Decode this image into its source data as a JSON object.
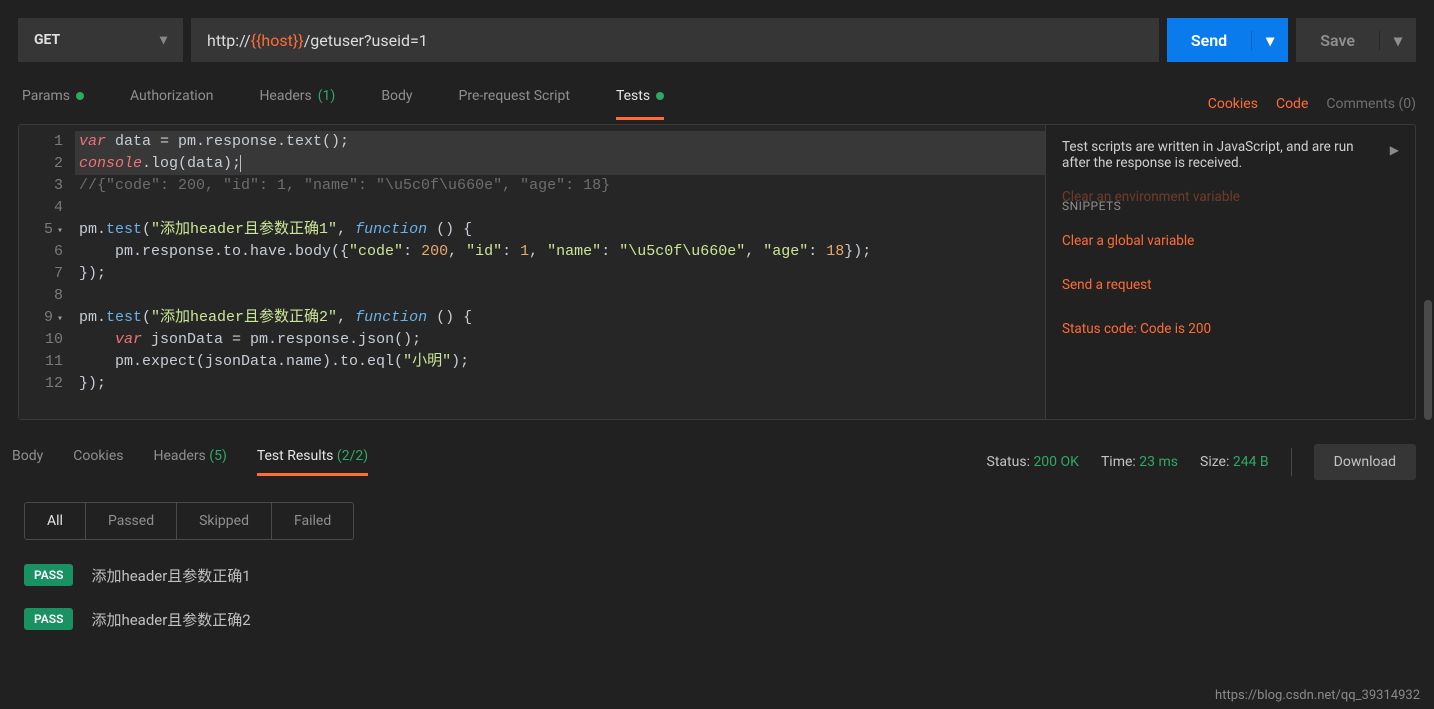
{
  "request": {
    "method": "GET",
    "url_prefix": "http://",
    "url_var": "{{host}}",
    "url_suffix": "/getuser?useid=1",
    "send_label": "Send",
    "save_label": "Save"
  },
  "tabs": {
    "params": "Params",
    "authorization": "Authorization",
    "headers": "Headers",
    "headers_count": "(1)",
    "body": "Body",
    "prerequest": "Pre-request Script",
    "tests": "Tests"
  },
  "right_links": {
    "cookies": "Cookies",
    "code": "Code",
    "comments": "Comments (0)"
  },
  "editor": {
    "lines": [
      "1",
      "2",
      "3",
      "4",
      "5",
      "6",
      "7",
      "8",
      "9",
      "10",
      "11",
      "12"
    ]
  },
  "code": {
    "l1_kw": "var",
    "l1_rest": " data = pm.response.text();",
    "l2_a": "console",
    "l2_b": ".log(data);",
    "l3": "//{\"code\": 200, \"id\": 1, \"name\": \"\\u5c0f\\u660e\", \"age\": 18}",
    "l5_a": "pm.",
    "l5_b": "test",
    "l5_c": "(",
    "l5_str": "\"添加header且参数正确1\"",
    "l5_d": ", ",
    "l5_fn": "function",
    "l5_e": " () {",
    "l6_a": "    pm.response.to.have.body({",
    "l6_k1": "\"code\"",
    "l6_c1": ": ",
    "l6_v1": "200",
    "l6_s1": ", ",
    "l6_k2": "\"id\"",
    "l6_c2": ": ",
    "l6_v2": "1",
    "l6_s2": ", ",
    "l6_k3": "\"name\"",
    "l6_c3": ": ",
    "l6_v3": "\"\\u5c0f\\u660e\"",
    "l6_s3": ", ",
    "l6_k4": "\"age\"",
    "l6_c4": ": ",
    "l6_v4": "18",
    "l6_end": "});",
    "l7": "});",
    "l9_a": "pm.",
    "l9_b": "test",
    "l9_c": "(",
    "l9_str": "\"添加header且参数正确2\"",
    "l9_d": ", ",
    "l9_fn": "function",
    "l9_e": " () {",
    "l10_kw": "var",
    "l10_rest": " jsonData = pm.response.json();",
    "l11_a": "    pm.expect(jsonData.name).to.eql(",
    "l11_str": "\"小明\"",
    "l11_end": ");",
    "l12": "});"
  },
  "side": {
    "info": "Test scripts are written in JavaScript, and are run after the response is received.",
    "snip_head": "SNIPPETS",
    "snip_cut": "Clear an environment variable",
    "s1": "Clear a global variable",
    "s2": "Send a request",
    "s3": "Status code: Code is 200"
  },
  "response": {
    "tabs": {
      "body": "Body",
      "cookies": "Cookies",
      "headers": "Headers",
      "headers_count": "(5)",
      "testresults": "Test Results",
      "testresults_count": "(2/2)"
    },
    "status_label": "Status:",
    "status_value": "200 OK",
    "time_label": "Time:",
    "time_value": "23 ms",
    "size_label": "Size:",
    "size_value": "244 B",
    "download": "Download"
  },
  "filters": {
    "all": "All",
    "passed": "Passed",
    "skipped": "Skipped",
    "failed": "Failed"
  },
  "results": [
    {
      "badge": "PASS",
      "name": "添加header且参数正确1"
    },
    {
      "badge": "PASS",
      "name": "添加header且参数正确2"
    }
  ],
  "watermark": "https://blog.csdn.net/qq_39314932"
}
